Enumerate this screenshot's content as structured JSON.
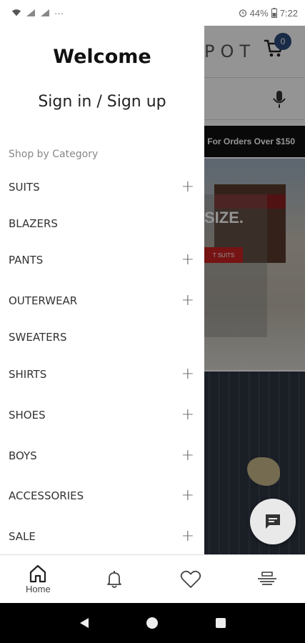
{
  "status_bar": {
    "battery": "44%",
    "time": "7:22"
  },
  "background": {
    "logo": "POT",
    "cart_count": "0",
    "banner": "For Orders Over $150",
    "hero_text": "SIZE.",
    "hero_button": "T SUITS"
  },
  "drawer": {
    "welcome": "Welcome",
    "sign_in": "Sign in / Sign up",
    "section_label": "Shop by Category",
    "categories": [
      {
        "label": "SUITS",
        "expandable": true
      },
      {
        "label": "BLAZERS",
        "expandable": false
      },
      {
        "label": "PANTS",
        "expandable": true
      },
      {
        "label": "OUTERWEAR",
        "expandable": true
      },
      {
        "label": "SWEATERS",
        "expandable": false
      },
      {
        "label": "SHIRTS",
        "expandable": true
      },
      {
        "label": "SHOES",
        "expandable": true
      },
      {
        "label": "BOYS",
        "expandable": true
      },
      {
        "label": "ACCESSORIES",
        "expandable": true
      },
      {
        "label": "SALE",
        "expandable": true
      }
    ],
    "plus_symbol": "+"
  },
  "bottom_nav": {
    "items": [
      {
        "label": "Home",
        "icon": "home-icon"
      },
      {
        "label": "",
        "icon": "bell-icon"
      },
      {
        "label": "",
        "icon": "heart-icon"
      },
      {
        "label": "",
        "icon": "list-icon"
      }
    ]
  },
  "colors": {
    "badge": "#2b4a7a",
    "banner": "#111111",
    "drawer_bg": "#ffffff"
  }
}
